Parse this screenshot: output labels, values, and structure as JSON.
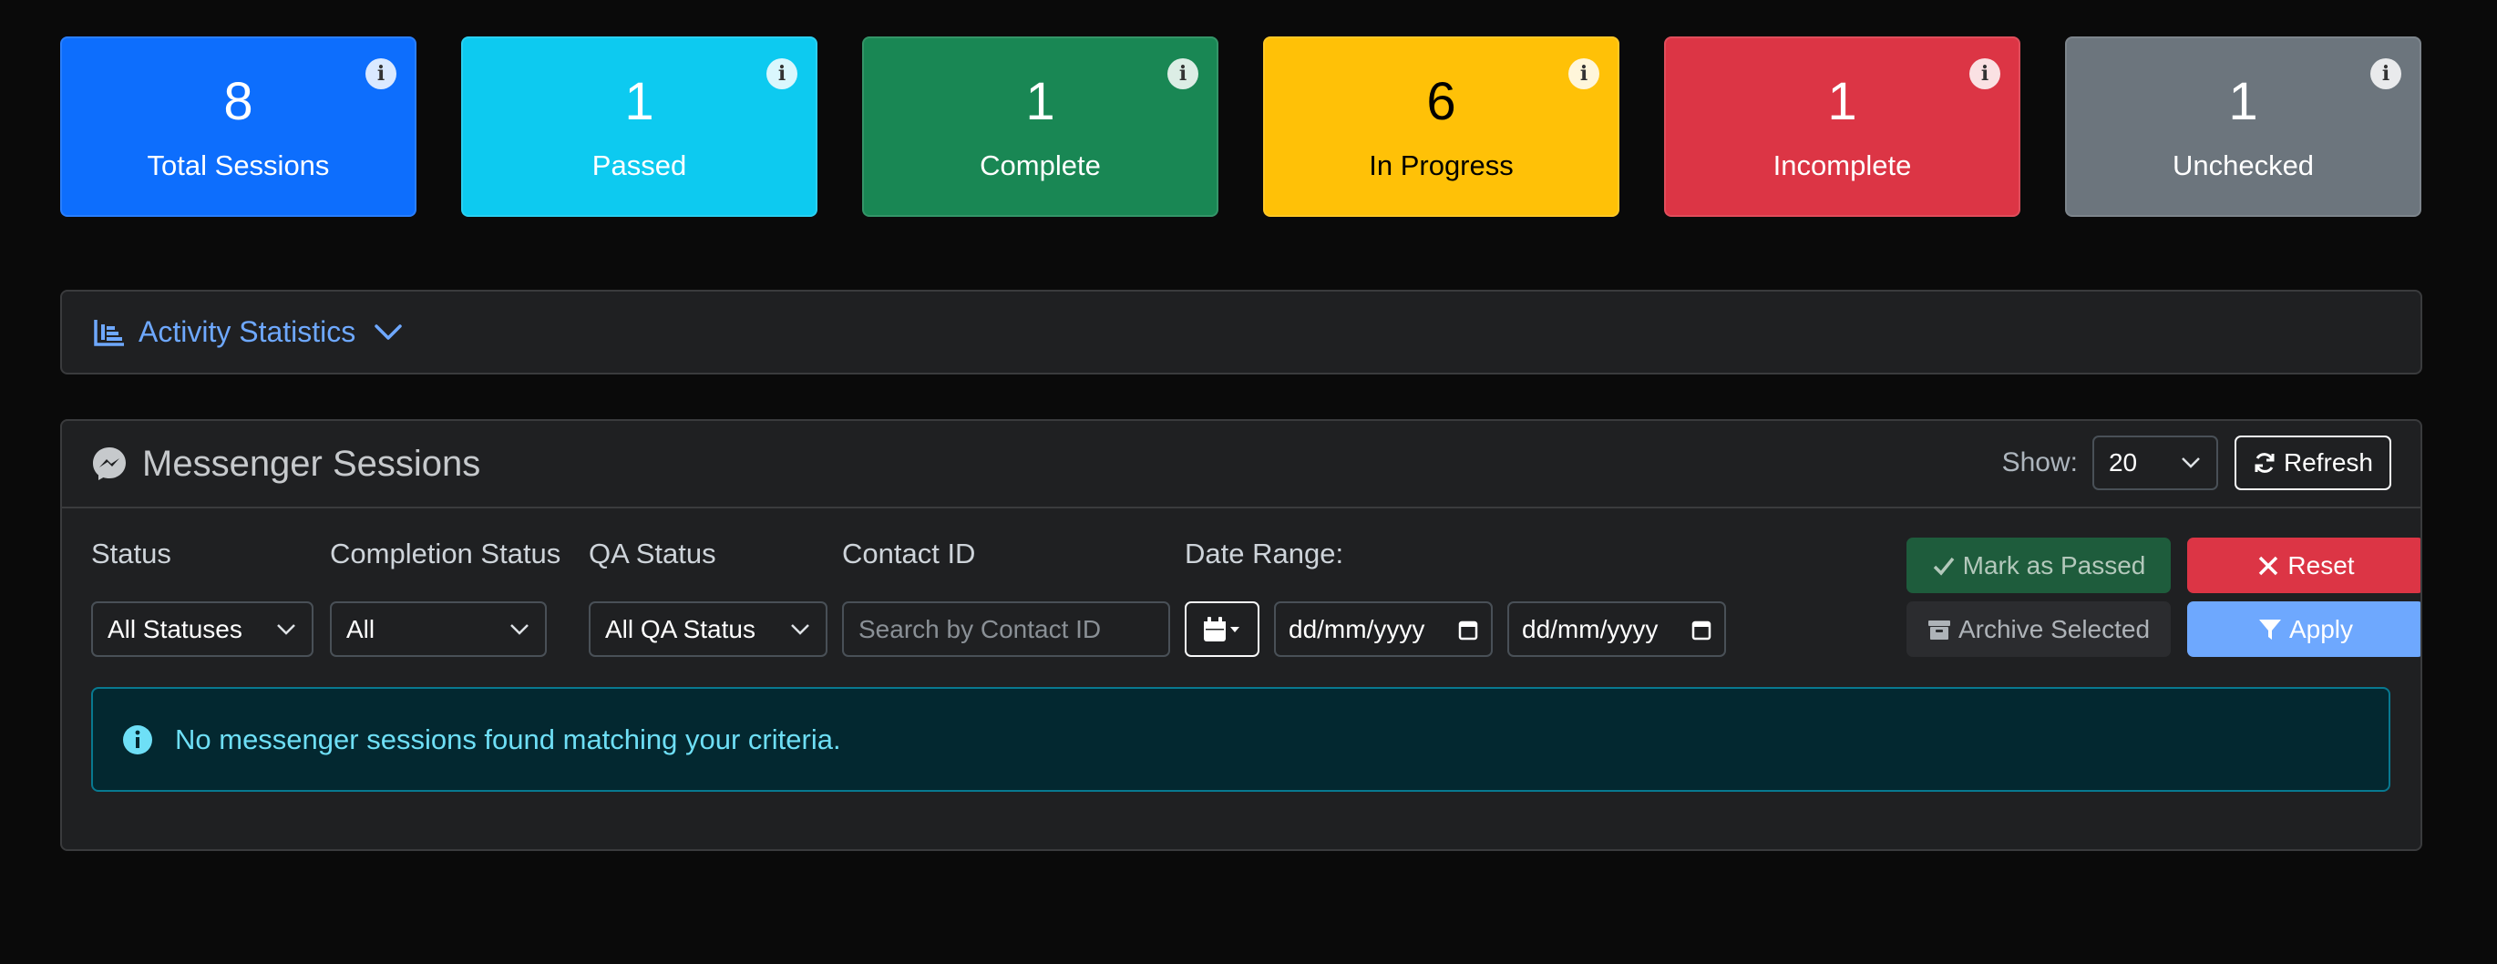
{
  "stats": [
    {
      "value": "8",
      "label": "Total Sessions",
      "color": "#0d6efd"
    },
    {
      "value": "1",
      "label": "Passed",
      "color": "#0dcaf0"
    },
    {
      "value": "1",
      "label": "Complete",
      "color": "#198754"
    },
    {
      "value": "6",
      "label": "In Progress",
      "color": "#ffc107"
    },
    {
      "value": "1",
      "label": "Incomplete",
      "color": "#dc3545"
    },
    {
      "value": "1",
      "label": "Unchecked",
      "color": "#6c757d"
    }
  ],
  "info_glyph": "i",
  "activity": {
    "title": "Activity Statistics",
    "icon": "chart-icon"
  },
  "sessions": {
    "title": "Messenger Sessions",
    "icon": "messenger-icon",
    "show_label": "Show:",
    "page_size": "20",
    "refresh_label": "Refresh"
  },
  "filters": {
    "status_label": "Status",
    "status_value": "All Statuses",
    "completion_label": "Completion Status",
    "completion_value": "All",
    "qa_label": "QA Status",
    "qa_value": "All QA Status",
    "contact_label": "Contact ID",
    "contact_placeholder": "Search by Contact ID",
    "date_label": "Date Range:",
    "date_from": "dd/mm/yyyy",
    "date_to": "dd/mm/yyyy"
  },
  "actions": {
    "mark_passed": "Mark as Passed",
    "reset": "Reset",
    "archive": "Archive Selected",
    "apply": "Apply"
  },
  "alert": {
    "message": "No messenger sessions found matching your criteria."
  },
  "colors": {
    "accent": "#6ea8fe",
    "info_text": "#6edff6"
  }
}
